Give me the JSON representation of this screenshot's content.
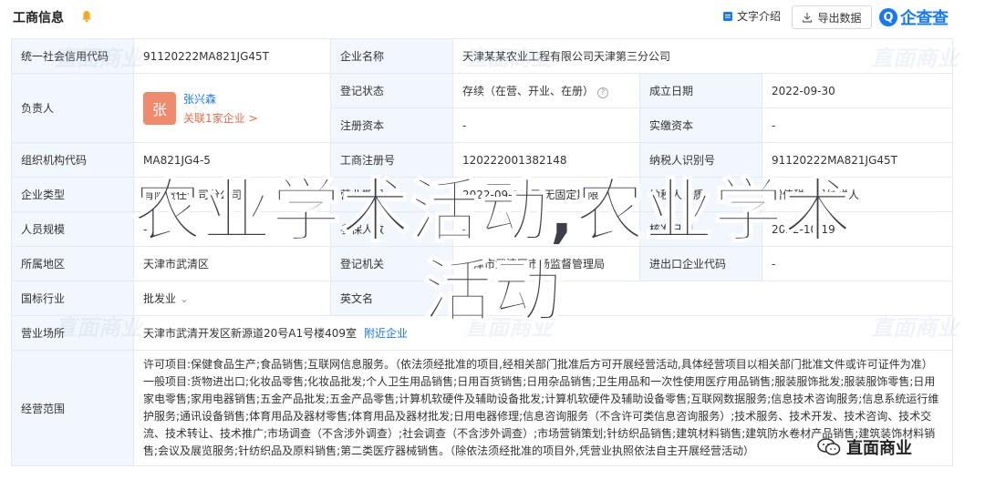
{
  "header": {
    "title": "工商信息",
    "intro_label": "文字介绍",
    "export_label": "导出数据",
    "logo_text": "企查查",
    "logo_mark": "Q"
  },
  "rows": {
    "credit_code_label": "统一社会信用代码",
    "credit_code": "91120222MA821JG45T",
    "company_name_label": "企业名称",
    "company_name": "天津某某农业工程有限公司天津第三分公司",
    "legal_person_label": "负责人",
    "avatar_char": "张",
    "person_name": "张兴森",
    "person_link": "关联1家企业 >",
    "reg_status_label": "登记状态",
    "reg_status": "存续（在营、开业、在册）",
    "established_label": "成立日期",
    "established": "2022-09-30",
    "reg_capital_label": "注册资本",
    "reg_capital": "-",
    "paid_capital_label": "实缴资本",
    "paid_capital": "-",
    "org_code_label": "组织机构代码",
    "org_code": "MA821JG4-5",
    "reg_no_label": "工商注册号",
    "reg_no": "120222001382148",
    "taxpayer_label": "纳税人识别号",
    "taxpayer": "91120222MA821JG45T",
    "company_type_label": "企业类型",
    "company_type": "有限责任公司分公司",
    "term_label": "营业期限",
    "term": "2022-09-30 至 无固定期限",
    "taxpayer_quality_label": "纳税人资质",
    "taxpayer_quality": "增值税一般纳税人",
    "staff_label": "人员规模",
    "staff": "-",
    "insured_label": "参保人数",
    "insured": "-",
    "approval_label": "核准日期",
    "approval": "2022-10-19",
    "region_label": "所属地区",
    "region": "天津市武清区",
    "authority_label": "登记机关",
    "authority": "天津市武清区市场监督管理局",
    "import_export_label": "进出口企业代码",
    "import_export": "-",
    "industry_label": "国标行业",
    "industry": "批发业",
    "english_name_label": "英文名",
    "english_name": "",
    "address_label": "营业场所",
    "address": "天津市武清开发区新源道20号A1号楼409室",
    "near_label": "附近企业",
    "scope_label": "经营范围",
    "scope": "许可项目:保健食品生产;食品销售;互联网信息服务。（依法须经批准的项目,经相关部门批准后方可开展经营活动,具体经营项目以相关部门批准文件或许可证件为准）一般项目:货物进出口;化妆品零售;化妆品批发;个人卫生用品销售;日用百货销售;日用杂品销售;卫生用品和一次性使用医疗用品销售;服装服饰批发;服装服饰零售;日用家电零售;家用电器销售;五金产品批发;五金产品零售;计算机软硬件及辅助设备批发;计算机软硬件及辅助设备零售;互联网数据服务;信息技术咨询服务;信息系统运行维护服务;通讯设备销售;体育用品及器材零售;体育用品及器材批发;日用电器修理;信息咨询服务（不含许可类信息咨询服务）;技术服务、技术开发、技术咨询、技术交流、技术转让、技术推广;市场调查（不含涉外调查）;社会调查（不含涉外调查）;市场营销策划;针纺织品销售;建筑材料销售;建筑防水卷材产品销售;建筑装饰材料销售;会议及展览服务;针纺织品及原料销售;第二类医疗器械销售。（除依法须经批准的项目外,凭营业执照依法自主开展经营活动）"
  },
  "overlay": {
    "line1": "农业学术活动,农业学术",
    "line2": "活动"
  },
  "watermark_text": "直面商业",
  "wechat_label": "直面商业"
}
